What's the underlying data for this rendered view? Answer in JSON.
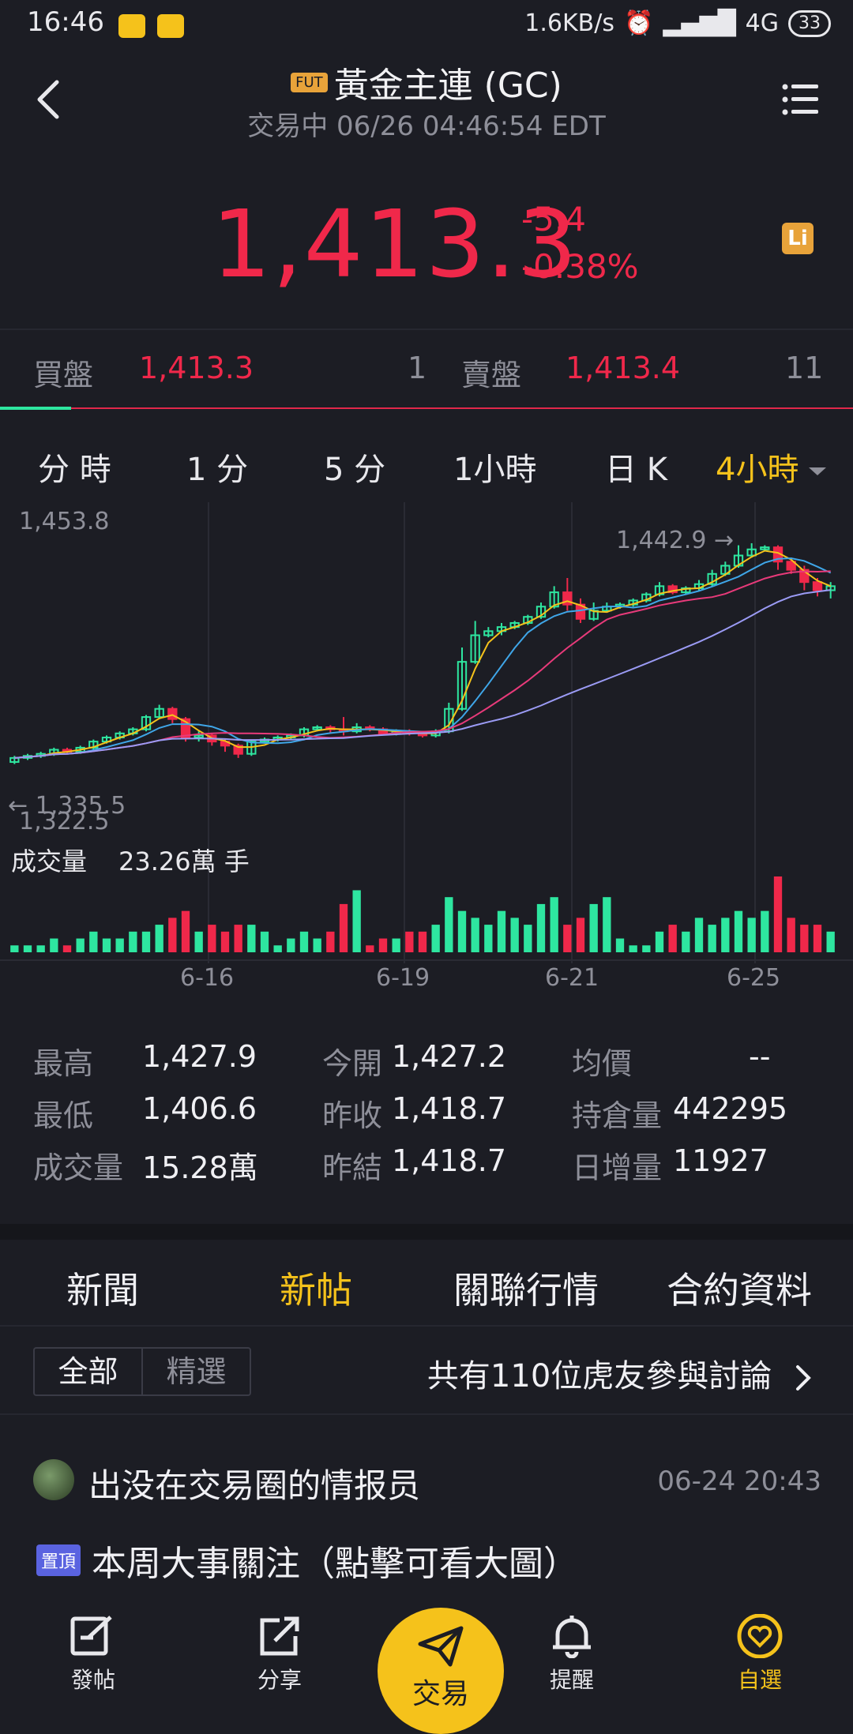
{
  "status_bar": {
    "time": "16:46",
    "speed": "1.6KB/s",
    "network": "4G",
    "battery": "33"
  },
  "header": {
    "badge": "FUT",
    "title": "黃金主連 (GC)",
    "subtitle": "交易中 06/26 04:46:54 EDT",
    "back_icon": "chevron-left-icon",
    "menu_icon": "list-icon"
  },
  "quote": {
    "price": "1,413.3",
    "change": "-5.4",
    "change_pct": "-0.38%",
    "li_badge": "Li"
  },
  "orderbook": {
    "bid_label": "買盤",
    "bid_price": "1,413.3",
    "bid_qty": "1",
    "ask_label": "賣盤",
    "ask_price": "1,413.4",
    "ask_qty": "11"
  },
  "periods": [
    "分 時",
    "1 分",
    "5 分",
    "1小時",
    "日 K",
    "4小時"
  ],
  "active_period": "4小時",
  "chart_labels": {
    "high": "1,453.8",
    "low": "1,322.5",
    "peak_marker": "1,442.9 →",
    "trough_marker": "← 1,335.5",
    "volume_label": "成交量",
    "volume_value": "23.26萬 手",
    "dates": [
      "6-16",
      "6-19",
      "6-21",
      "6-25"
    ]
  },
  "chart_data": {
    "type": "candlestick",
    "y_range": [
      1322.5,
      1453.8
    ],
    "x_ticks": [
      "6-16",
      "6-19",
      "6-21",
      "6-25"
    ],
    "colors": {
      "up": "#2ee6a0",
      "down": "#f0284a",
      "ma5": "#f5c21b",
      "ma10": "#3fa6e8",
      "ma20": "#e83a7a",
      "ma60": "#9b9bf5"
    },
    "candles": [
      [
        1336,
        1338,
        1335,
        1339,
        1
      ],
      [
        1338,
        1339,
        1337,
        1340,
        1
      ],
      [
        1339,
        1340,
        1338,
        1341,
        1
      ],
      [
        1340,
        1342,
        1339,
        1343,
        2
      ],
      [
        1342,
        1341,
        1340,
        1343,
        1
      ],
      [
        1341,
        1343,
        1340,
        1344,
        2
      ],
      [
        1343,
        1346,
        1342,
        1347,
        3
      ],
      [
        1346,
        1348,
        1345,
        1349,
        2
      ],
      [
        1348,
        1350,
        1347,
        1351,
        2
      ],
      [
        1350,
        1352,
        1349,
        1353,
        3
      ],
      [
        1352,
        1358,
        1351,
        1359,
        3
      ],
      [
        1358,
        1362,
        1357,
        1364,
        4
      ],
      [
        1362,
        1357,
        1355,
        1363,
        5
      ],
      [
        1357,
        1348,
        1346,
        1358,
        6
      ],
      [
        1348,
        1349,
        1346,
        1351,
        3
      ],
      [
        1349,
        1346,
        1344,
        1350,
        4
      ],
      [
        1346,
        1344,
        1341,
        1347,
        3
      ],
      [
        1344,
        1340,
        1338,
        1345,
        4
      ],
      [
        1340,
        1346,
        1339,
        1347,
        4
      ],
      [
        1346,
        1347,
        1345,
        1348,
        3
      ],
      [
        1347,
        1348,
        1346,
        1349,
        1
      ],
      [
        1348,
        1349,
        1347,
        1350,
        2
      ],
      [
        1349,
        1352,
        1348,
        1353,
        3
      ],
      [
        1352,
        1353,
        1351,
        1354,
        2
      ],
      [
        1353,
        1352,
        1350,
        1354,
        3
      ],
      [
        1352,
        1351,
        1349,
        1358,
        7
      ],
      [
        1351,
        1353,
        1350,
        1355,
        9
      ],
      [
        1353,
        1352,
        1351,
        1354,
        1
      ],
      [
        1352,
        1350,
        1349,
        1353,
        2
      ],
      [
        1350,
        1351,
        1349,
        1352,
        2
      ],
      [
        1351,
        1350,
        1349,
        1352,
        3
      ],
      [
        1350,
        1349,
        1348,
        1351,
        3
      ],
      [
        1349,
        1351,
        1348,
        1352,
        4
      ],
      [
        1351,
        1362,
        1350,
        1365,
        8
      ],
      [
        1362,
        1385,
        1361,
        1392,
        6
      ],
      [
        1385,
        1398,
        1384,
        1405,
        5
      ],
      [
        1398,
        1400,
        1397,
        1402,
        4
      ],
      [
        1400,
        1402,
        1398,
        1404,
        6
      ],
      [
        1402,
        1404,
        1401,
        1405,
        5
      ],
      [
        1404,
        1407,
        1403,
        1408,
        4
      ],
      [
        1407,
        1412,
        1406,
        1414,
        7
      ],
      [
        1412,
        1419,
        1411,
        1422,
        8
      ],
      [
        1419,
        1413,
        1410,
        1426,
        4
      ],
      [
        1413,
        1406,
        1404,
        1416,
        5
      ],
      [
        1406,
        1410,
        1405,
        1414,
        7
      ],
      [
        1410,
        1412,
        1409,
        1414,
        8
      ],
      [
        1412,
        1413,
        1411,
        1414,
        2
      ],
      [
        1413,
        1415,
        1412,
        1416,
        1
      ],
      [
        1415,
        1418,
        1414,
        1419,
        1
      ],
      [
        1418,
        1422,
        1417,
        1424,
        3
      ],
      [
        1422,
        1419,
        1418,
        1423,
        4
      ],
      [
        1419,
        1421,
        1418,
        1422,
        3
      ],
      [
        1421,
        1423,
        1420,
        1425,
        5
      ],
      [
        1423,
        1428,
        1422,
        1430,
        4
      ],
      [
        1428,
        1432,
        1427,
        1434,
        5
      ],
      [
        1432,
        1437,
        1431,
        1442,
        6
      ],
      [
        1437,
        1440,
        1436,
        1443,
        5
      ],
      [
        1440,
        1441,
        1439,
        1442,
        6
      ],
      [
        1441,
        1434,
        1430,
        1442,
        11
      ],
      [
        1434,
        1430,
        1428,
        1436,
        5
      ],
      [
        1430,
        1424,
        1420,
        1432,
        4
      ],
      [
        1424,
        1420,
        1417,
        1426,
        4
      ],
      [
        1420,
        1422,
        1416,
        1424,
        3
      ]
    ]
  },
  "stats": [
    {
      "k": "最高",
      "v": "1,427.9"
    },
    {
      "k": "今開",
      "v": "1,427.2"
    },
    {
      "k": "均價",
      "v": "--"
    },
    {
      "k": "最低",
      "v": "1,406.6"
    },
    {
      "k": "昨收",
      "v": "1,418.7"
    },
    {
      "k": "持倉量",
      "v": "442295"
    },
    {
      "k": "成交量",
      "v": "15.28萬"
    },
    {
      "k": "昨結",
      "v": "1,418.7"
    },
    {
      "k": "日增量",
      "v": "11927"
    }
  ],
  "section_tabs": [
    "新聞",
    "新帖",
    "關聯行情",
    "合約資料"
  ],
  "active_section": "新帖",
  "filter": {
    "all": "全部",
    "featured": "精選",
    "discussion": "共有110位虎友參與討論"
  },
  "post": {
    "author": "出没在交易圈的情报员",
    "time": "06-24 20:43",
    "pin": "置頂",
    "title": "本周大事關注（點擊可看大圖）"
  },
  "nav": [
    {
      "label": "發帖",
      "icon": "compose-icon"
    },
    {
      "label": "分享",
      "icon": "share-icon"
    },
    {
      "label": "交易",
      "icon": "send-icon"
    },
    {
      "label": "提醒",
      "icon": "bell-icon"
    },
    {
      "label": "自選",
      "icon": "heart-icon"
    }
  ]
}
